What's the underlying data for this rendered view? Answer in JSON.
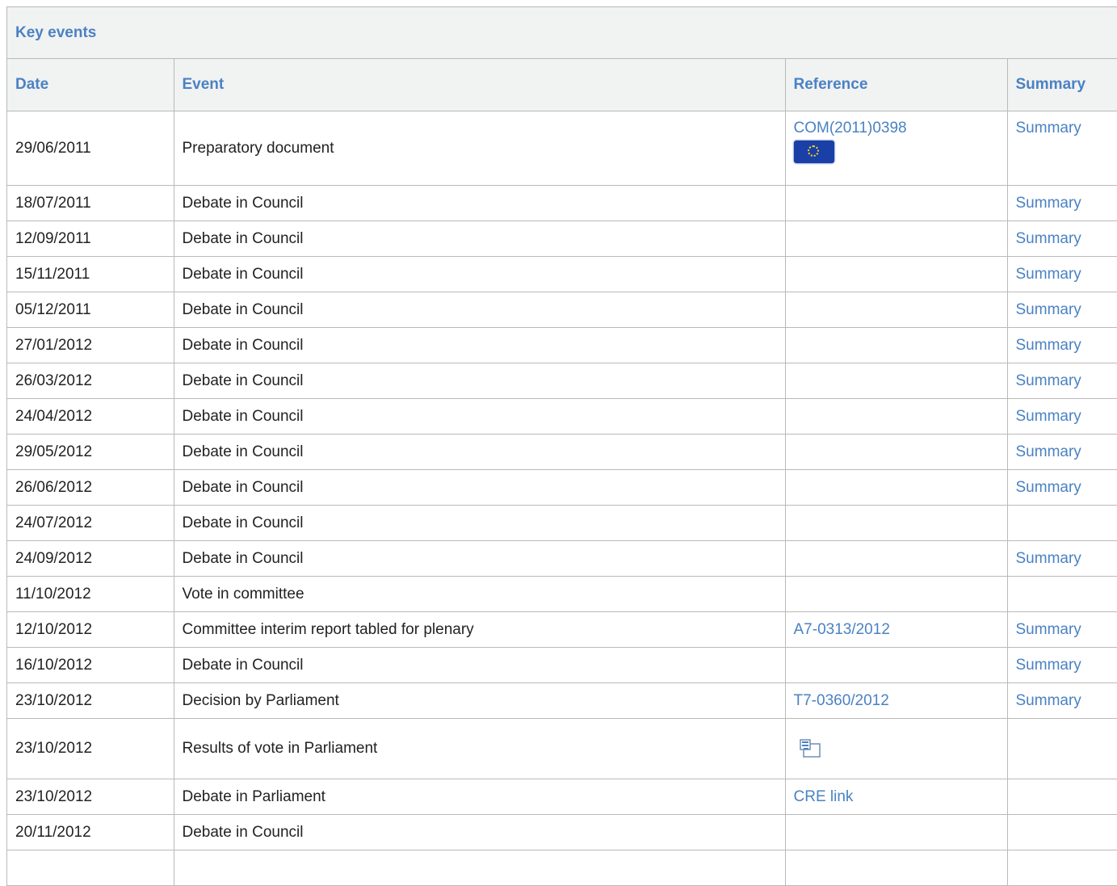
{
  "panel": {
    "title": "Key events"
  },
  "columns": {
    "date": "Date",
    "event": "Event",
    "reference": "Reference",
    "summary": "Summary"
  },
  "rows": [
    {
      "date": "29/06/2011",
      "event": "Preparatory document",
      "reference": "COM(2011)0398",
      "ref_icon": "eu-flag-icon",
      "summary": "Summary"
    },
    {
      "date": "18/07/2011",
      "event": "Debate in Council",
      "reference": "",
      "summary": "Summary"
    },
    {
      "date": "12/09/2011",
      "event": "Debate in Council",
      "reference": "",
      "summary": "Summary"
    },
    {
      "date": "15/11/2011",
      "event": "Debate in Council",
      "reference": "",
      "summary": "Summary"
    },
    {
      "date": "05/12/2011",
      "event": "Debate in Council",
      "reference": "",
      "summary": "Summary"
    },
    {
      "date": "27/01/2012",
      "event": "Debate in Council",
      "reference": "",
      "summary": "Summary"
    },
    {
      "date": "26/03/2012",
      "event": "Debate in Council",
      "reference": "",
      "summary": "Summary"
    },
    {
      "date": "24/04/2012",
      "event": "Debate in Council",
      "reference": "",
      "summary": "Summary"
    },
    {
      "date": "29/05/2012",
      "event": "Debate in Council",
      "reference": "",
      "summary": "Summary"
    },
    {
      "date": "26/06/2012",
      "event": "Debate in Council",
      "reference": "",
      "summary": "Summary"
    },
    {
      "date": "24/07/2012",
      "event": "Debate in Council",
      "reference": "",
      "summary": ""
    },
    {
      "date": "24/09/2012",
      "event": "Debate in Council",
      "reference": "",
      "summary": "Summary"
    },
    {
      "date": "11/10/2012",
      "event": "Vote in committee",
      "reference": "",
      "summary": ""
    },
    {
      "date": "12/10/2012",
      "event": "Committee interim report tabled for plenary",
      "reference": "A7-0313/2012",
      "summary": "Summary"
    },
    {
      "date": "16/10/2012",
      "event": "Debate in Council",
      "reference": "",
      "summary": "Summary"
    },
    {
      "date": "23/10/2012",
      "event": "Decision by Parliament",
      "reference": "T7-0360/2012",
      "summary": "Summary"
    },
    {
      "date": "23/10/2012",
      "event": "Results of vote in Parliament",
      "reference": "",
      "ref_icon": "vote-results-icon",
      "summary": ""
    },
    {
      "date": "23/10/2012",
      "event": "Debate in Parliament",
      "reference": "CRE link",
      "summary": ""
    },
    {
      "date": "20/11/2012",
      "event": "Debate in Council",
      "reference": "",
      "summary": ""
    },
    {
      "date": "",
      "event": "",
      "reference": "",
      "summary": ""
    }
  ],
  "colors": {
    "accent": "#4a82c3",
    "header_bg": "#f1f2f2",
    "border": "#b9b9b9"
  }
}
